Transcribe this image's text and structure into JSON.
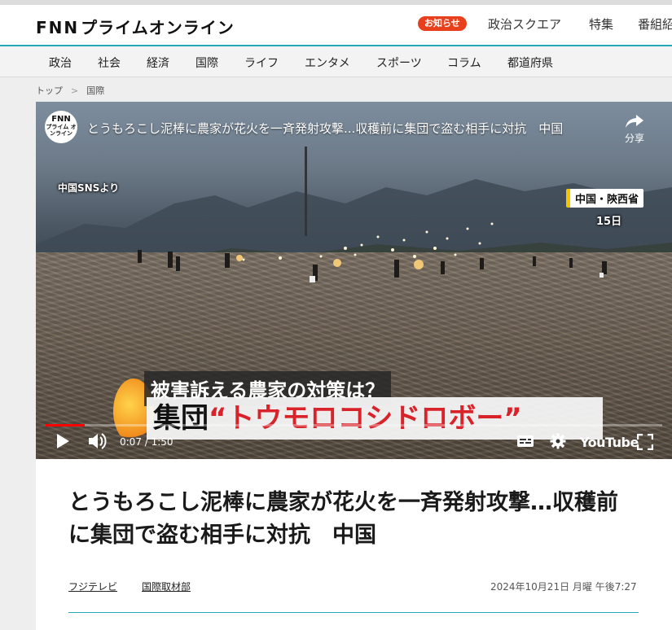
{
  "site": {
    "logo_fnn": "FNN",
    "logo_rest": "プライムオンライン"
  },
  "header": {
    "notice_badge": "お知らせ",
    "nav": [
      "政治スクエア",
      "特集",
      "番組紹介"
    ]
  },
  "categories": [
    "政治",
    "社会",
    "経済",
    "国際",
    "ライフ",
    "エンタメ",
    "スポーツ",
    "コラム",
    "都道府県"
  ],
  "breadcrumb": {
    "home": "トップ",
    "separator": ">",
    "current": "国際"
  },
  "video": {
    "channel_badge_top": "FNN",
    "channel_badge_bottom": "プライム オンライン",
    "title": "とうもろこし泥棒に農家が花火を一斉発射攻撃...収穫前に集団で盗む相手に対抗　中国",
    "share_label": "分享",
    "caption_source": "中国SNSより",
    "caption_location": "中国・陝西省",
    "caption_date": "15日",
    "telop_sub": "被害訴える農家の対策は？",
    "telop_main_prefix": "集団",
    "telop_main_highlight": "“トウモロコシドロボー”",
    "time_display": "0:07 / 1:50",
    "progress_fraction": 0.064,
    "youtube_label": "YouTube",
    "colors": {
      "progress": "#ff0000",
      "telop_highlight": "#d8232a"
    }
  },
  "article": {
    "headline": "とうもろこし泥棒に農家が花火を一斉発射攻撃…収穫前に集団で盗む相手に対抗　中国",
    "authors": [
      "フジテレビ",
      "国際取材部"
    ],
    "published": "2024年10月21日 月曜 午後7:27"
  },
  "colors": {
    "accent": "#28a7b5",
    "notice": "#e8401c"
  }
}
